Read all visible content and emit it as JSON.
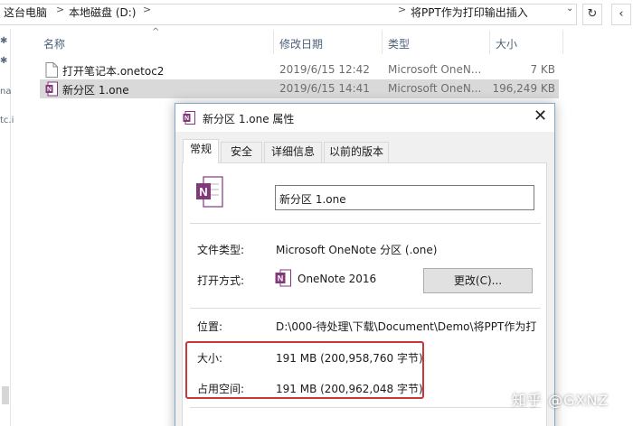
{
  "address_bar": {
    "crumbs": [
      "这台电脑",
      "本地磁盘 (D:)",
      "将PPT作为打印输出插入"
    ],
    "separator": ">",
    "dropdown_glyph": "⌄",
    "refresh_glyph": "↻",
    "back_glyph": "‹"
  },
  "nav": {
    "glyphs": [
      "✱",
      "✱",
      "na",
      "tc.i"
    ]
  },
  "columns": {
    "name": "名称",
    "date": "修改日期",
    "type": "类型",
    "size": "大小",
    "sort_glyph": "^"
  },
  "files": [
    {
      "name": "打开笔记本.onetoc2",
      "date": "2019/6/15 12:42",
      "type": "Microsoft OneN...",
      "size": "7 KB",
      "icon": "onetoc-file-icon",
      "selected": false
    },
    {
      "name": "新分区 1.one",
      "date": "2019/6/15 14:41",
      "type": "Microsoft OneN...",
      "size": "196,249 KB",
      "icon": "onenote-section-icon",
      "selected": true
    }
  ],
  "dialog": {
    "title": "新分区 1.one 属性",
    "close_glyph": "✕",
    "tabs": [
      "常规",
      "安全",
      "详细信息",
      "以前的版本"
    ],
    "active_tab": 0,
    "filename": "新分区 1.one",
    "rows": {
      "file_type_label": "文件类型:",
      "file_type_value": "Microsoft OneNote 分区 (.one)",
      "open_with_label": "打开方式:",
      "open_with_value": "OneNote 2016",
      "change_button": "更改(C)...",
      "location_label": "位置:",
      "location_value": "D:\\000-待处理\\下载\\Document\\Demo\\将PPT作为打",
      "size_label": "大小:",
      "size_value": "191 MB (200,958,760 字节)",
      "disk_size_label": "占用空间:",
      "disk_size_value": "191 MB (200,962,048 字节)"
    }
  },
  "watermark": "知乎 @GXNZ",
  "colors": {
    "onenote_purple": "#80397b",
    "highlight_red": "#c8373a",
    "selection_gray": "#d9d9d9"
  }
}
